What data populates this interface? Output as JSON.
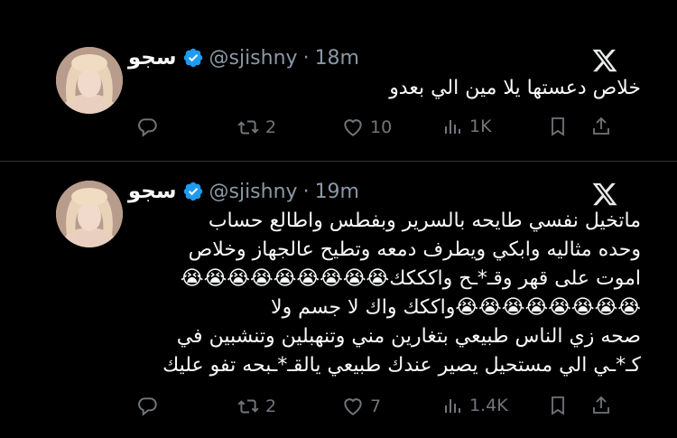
{
  "tweets": [
    {
      "name": "سجو",
      "handle": "@sjishny",
      "separator": "·",
      "time": "18m",
      "lines": [
        "خلاص دعستها يلا مين الي بعدو"
      ],
      "retweets": "2",
      "likes": "10",
      "views": "1K"
    },
    {
      "name": "سجو",
      "handle": "@sjishny",
      "separator": "·",
      "time": "19m",
      "lines": [
        "ماتخيل نفسي طايحه بالسرير وبفطس واطالع حساب",
        "وحده مثاليه وابكي ويطرف دمعه وتطيح عالجهاز وخلاص",
        "اموت على قهر وقـ*ـح واكككك😭😭😭😭😭😭😭😭😭",
        "😭😭😭😭😭😭😭😭واككك واك لا جسم ولا",
        "صحه زي الناس طبيعي بتغارين مني وتنهبلين وتنشبين في",
        "كـ*ـي الي مستحيل يصير عندك طبيعي يالقـ*ـبحه تفو عليك"
      ],
      "retweets": "2",
      "likes": "7",
      "views": "1.4K"
    }
  ],
  "icons": {
    "reply": "reply-icon",
    "retweet": "retweet-icon",
    "like": "heart-icon",
    "views": "views-icon",
    "bookmark": "bookmark-icon",
    "share": "share-icon",
    "platform": "x-logo-icon",
    "verified": "verified-badge-icon"
  },
  "colors": {
    "background": "#000000",
    "text": "#e7e9ea",
    "secondary": "#71767b",
    "verified": "#1d9bf0"
  }
}
